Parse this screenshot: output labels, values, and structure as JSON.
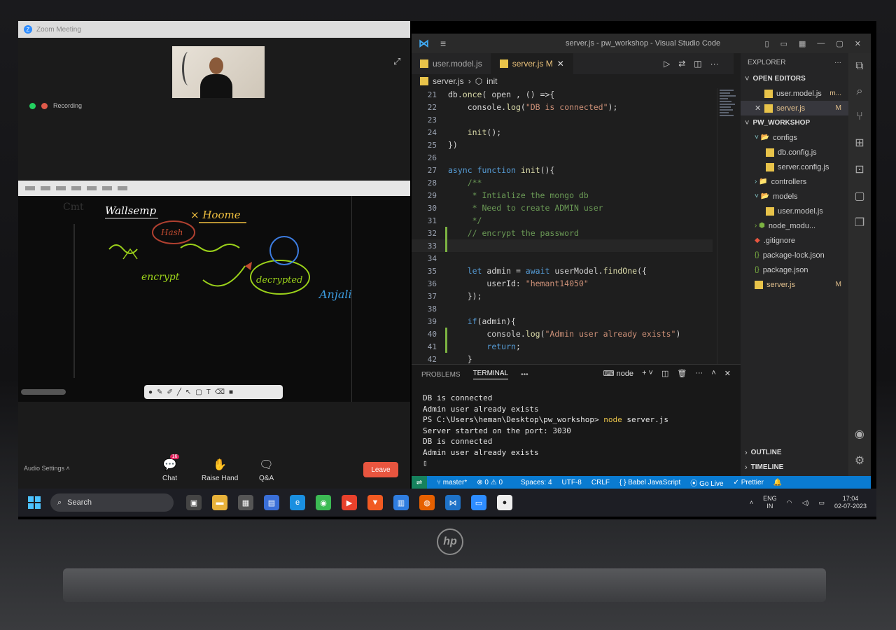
{
  "zoom": {
    "window_title": "Zoom Meeting",
    "recording_label": "Recording",
    "audio_settings": "Audio Settings",
    "chat_label": "Chat",
    "chat_badge": "16",
    "raise_hand_label": "Raise Hand",
    "qa_label": "Q&A",
    "leave_label": "Leave",
    "whiteboard_notes": [
      "Wallsemp",
      "× Hoome",
      "Hash",
      "encrypt",
      "decrypted",
      "Anjali"
    ]
  },
  "vscode": {
    "window_title": "server.js - pw_workshop - Visual Studio Code",
    "tabs": [
      {
        "label": "user.model.js",
        "active": false
      },
      {
        "label": "server.js M",
        "active": true
      }
    ],
    "breadcrumb": {
      "file": "server.js",
      "symbol": "init"
    },
    "code_lines": [
      {
        "n": "21",
        "text": "db.once( open , () =>{"
      },
      {
        "n": "22",
        "text": "    console.log(\"DB is connected\");"
      },
      {
        "n": "23",
        "text": ""
      },
      {
        "n": "24",
        "text": "    init();"
      },
      {
        "n": "25",
        "text": "})"
      },
      {
        "n": "26",
        "text": ""
      },
      {
        "n": "27",
        "text": "async function init(){"
      },
      {
        "n": "28",
        "text": "    /**"
      },
      {
        "n": "29",
        "text": "     * Intialize the mongo db"
      },
      {
        "n": "30",
        "text": "     * Need to create ADMIN user"
      },
      {
        "n": "31",
        "text": "     */"
      },
      {
        "n": "32",
        "text": "    // encrypt the password"
      },
      {
        "n": "33",
        "text": ""
      },
      {
        "n": "34",
        "text": ""
      },
      {
        "n": "35",
        "text": "    let admin = await userModel.findOne({"
      },
      {
        "n": "36",
        "text": "        userId: \"hemant14050\""
      },
      {
        "n": "37",
        "text": "    });"
      },
      {
        "n": "38",
        "text": ""
      },
      {
        "n": "39",
        "text": "    if(admin){"
      },
      {
        "n": "40",
        "text": "        console.log(\"Admin user already exists\")"
      },
      {
        "n": "41",
        "text": "        return;"
      },
      {
        "n": "42",
        "text": "    }"
      }
    ],
    "panel": {
      "problems": "PROBLEMS",
      "terminal": "TERMINAL",
      "more": "•••",
      "shell": "node",
      "output": [
        "DB is connected",
        "Admin user already exists",
        "PS C:\\Users\\heman\\Desktop\\pw_workshop> ",
        "Server started on the port: 3030",
        "DB is connected",
        "Admin user already exists"
      ],
      "command": "node",
      "command_arg": " server.js"
    },
    "explorer": {
      "title": "EXPLORER",
      "open_editors": "OPEN EDITORS",
      "open_files": [
        {
          "name": "user.model.js",
          "mark": "m..."
        },
        {
          "name": "server.js",
          "mark": "M"
        }
      ],
      "workspace": "PW_WORKSHOP",
      "tree": [
        {
          "name": "configs",
          "kind": "folder-open",
          "depth": 1
        },
        {
          "name": "db.config.js",
          "kind": "js",
          "depth": 2
        },
        {
          "name": "server.config.js",
          "kind": "js",
          "depth": 2
        },
        {
          "name": "controllers",
          "kind": "folder",
          "depth": 1
        },
        {
          "name": "models",
          "kind": "folder-open",
          "depth": 1
        },
        {
          "name": "user.model.js",
          "kind": "js",
          "depth": 2
        },
        {
          "name": "node_modu...",
          "kind": "node",
          "depth": 1
        },
        {
          "name": ".gitignore",
          "kind": "git",
          "depth": 1
        },
        {
          "name": "package-lock.json",
          "kind": "json",
          "depth": 1
        },
        {
          "name": "package.json",
          "kind": "json",
          "depth": 1
        },
        {
          "name": "server.js",
          "kind": "js",
          "depth": 1,
          "mark": "M"
        }
      ],
      "outline": "OUTLINE",
      "timeline": "TIMELINE"
    },
    "status": {
      "branch": "master*",
      "problems": "⊗ 0 ⚠ 0",
      "spaces": "Spaces: 4",
      "encoding": "UTF-8",
      "eol": "CRLF",
      "language": "{ } Babel JavaScript",
      "golive": "Go Live",
      "prettier": "✓ Prettier"
    }
  },
  "taskbar": {
    "search_placeholder": "Search",
    "lang": "ENG",
    "region": "IN",
    "time": "17:04",
    "date": "02-07-2023"
  },
  "brand": "hp"
}
